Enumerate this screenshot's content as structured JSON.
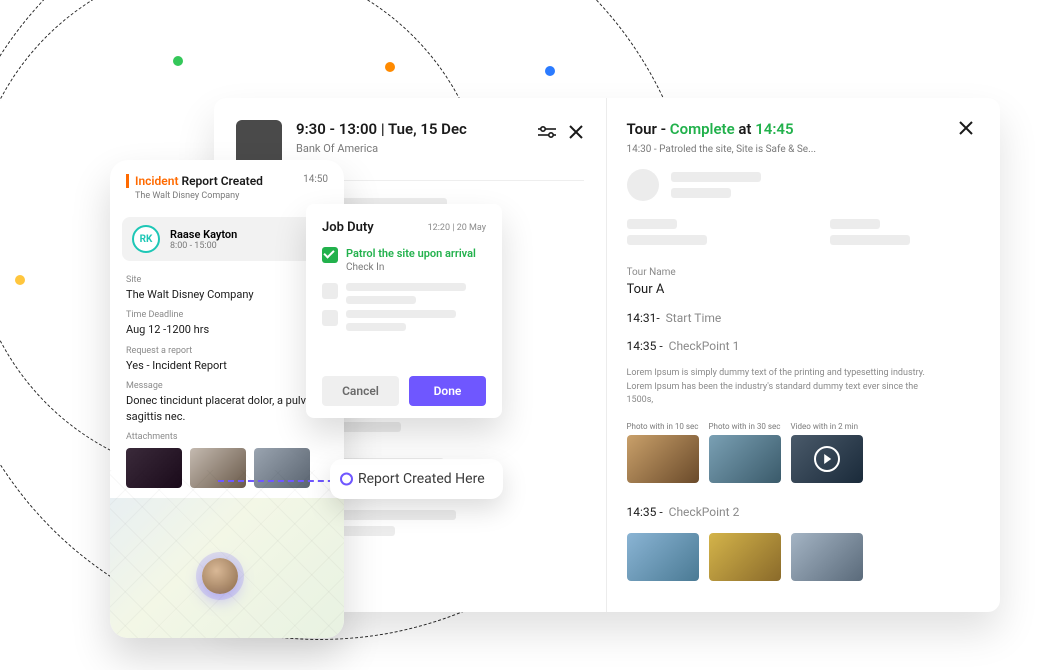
{
  "backPanel": {
    "timeRange": "9:30 - 13:00",
    "separator": "  |  ",
    "date": "Tue, 15 Dec",
    "subtitle": "Bank Of America"
  },
  "tour": {
    "prefix": "Tour - ",
    "status": "Complete",
    "mid": " at ",
    "time": "14:45",
    "sub": "14:30 - Patroled the site, Site is Safe & Se...",
    "tourNameLabel": "Tour Name",
    "tourNameValue": "Tour A",
    "startTime": "14:31",
    "startLabel": "Start Time",
    "cp1_t": "14:35",
    "cp1_l": "CheckPoint 1",
    "desc": "Lorem Ipsum is simply dummy text of the printing and typesetting industry. Lorem Ipsum has been the industry's standard dummy text ever since the 1500s,",
    "thumb1_lab": "Photo with in 10 sec",
    "thumb2_lab": "Photo with in 30 sec",
    "thumb3_lab": "Video with in 2 min",
    "cp2_t": "14:35",
    "cp2_l": "CheckPoint 2"
  },
  "phone": {
    "titlePrefix": "Incident",
    "titleRest": " Report Created",
    "titleTime": "14:50",
    "companySub": "The Walt Disney Company",
    "user": {
      "initials": "RK",
      "name": "Raase Kayton",
      "hours": "8:00 - 15:00"
    },
    "siteLabel": "Site",
    "siteValue": "The Walt Disney Company",
    "deadlineLabel": "Time Deadline",
    "deadlineValue": "Aug 12 -1200 hrs",
    "reportLabel": "Request a report",
    "reportValue": "Yes - Incident Report",
    "messageLabel": "Message",
    "messageValue": "Donec tincidunt placerat dolor, a pulvinar sagittis nec.",
    "attachLabel": "Attachments"
  },
  "tag": {
    "text": "Report Created Here"
  },
  "duty": {
    "title": "Job Duty",
    "date": "12:20 | 20 May",
    "item1": "Patrol the site upon arrival",
    "item1sub": "Check In",
    "cancel": "Cancel",
    "done": "Done"
  }
}
